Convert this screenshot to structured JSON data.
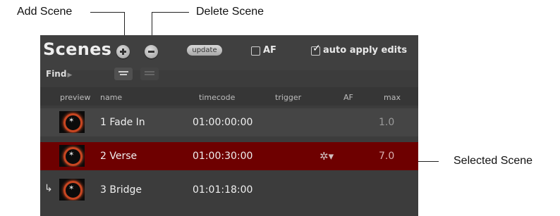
{
  "callouts": {
    "add_scene": "Add Scene",
    "delete_scene": "Delete Scene",
    "selected_scene": "Selected Scene"
  },
  "panel": {
    "title": "Scenes",
    "update_label": "update",
    "af_label": "AF",
    "af_checked": false,
    "auto_apply_label": "auto apply edits",
    "auto_apply_checked": true,
    "find_label": "Find"
  },
  "columns": {
    "preview": "preview",
    "name": "name",
    "timecode": "timecode",
    "trigger": "trigger",
    "af": "AF",
    "max": "max"
  },
  "scenes": [
    {
      "name": "1 Fade In",
      "timecode": "01:00:00:00",
      "max": "1.0",
      "selected": false,
      "trigger_icon": "",
      "indent_icon": ""
    },
    {
      "name": "2 Verse",
      "timecode": "01:00:30:00",
      "max": "7.0",
      "selected": true,
      "trigger_icon": "gear-icon",
      "indent_icon": ""
    },
    {
      "name": "3 Bridge",
      "timecode": "01:01:18:00",
      "max": "",
      "selected": false,
      "trigger_icon": "",
      "indent_icon": "return-arrow-icon"
    }
  ],
  "colors": {
    "selected_row": "#6e0000",
    "panel_bg": "#3c3c3c",
    "preview_ring": "#c84621"
  },
  "check_glyph": "✓",
  "gear_glyph": "✲▾",
  "indent_glyph": "↳",
  "find_arrow_glyph": "▶",
  "star_glyph": "✶"
}
